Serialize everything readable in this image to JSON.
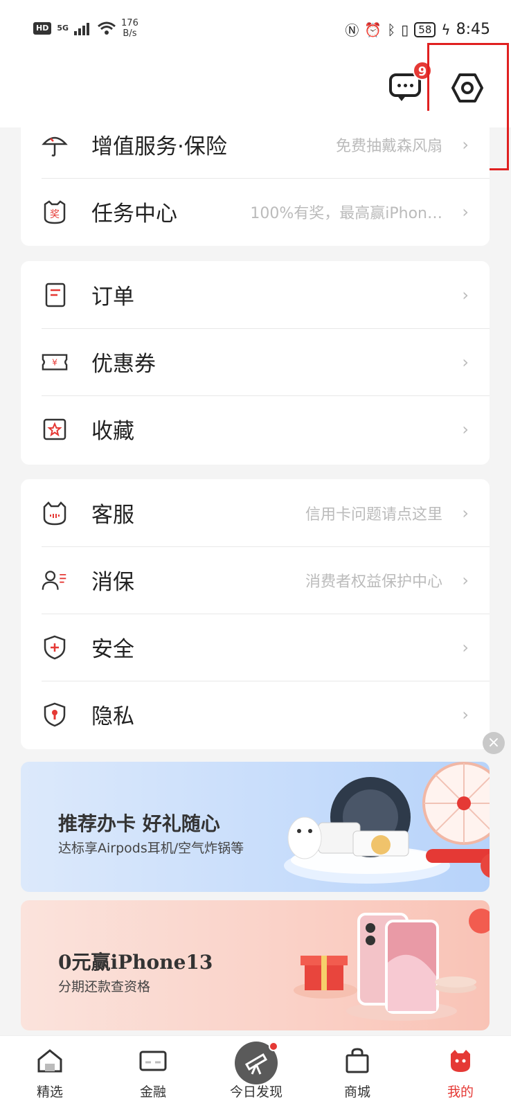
{
  "status_bar": {
    "hd": "HD",
    "network": "5G",
    "speed_value": "176",
    "speed_unit": "B/s",
    "battery": "58",
    "time": "8:45"
  },
  "header": {
    "message_badge": "9"
  },
  "card1": {
    "items": [
      {
        "label": "增值服务·保险",
        "hint": "免费抽戴森风扇",
        "icon": "umbrella-icon"
      },
      {
        "label": "任务中心",
        "hint": "100%有奖，最高赢iPhon…",
        "icon": "reward-cat-icon"
      }
    ]
  },
  "card2": {
    "items": [
      {
        "label": "订单",
        "hint": "",
        "icon": "order-icon"
      },
      {
        "label": "优惠券",
        "hint": "",
        "icon": "coupon-icon"
      },
      {
        "label": "收藏",
        "hint": "",
        "icon": "favorite-icon"
      }
    ]
  },
  "card3": {
    "items": [
      {
        "label": "客服",
        "hint": "信用卡问题请点这里",
        "icon": "customer-service-icon"
      },
      {
        "label": "消保",
        "hint": "消费者权益保护中心",
        "icon": "consumer-protection-icon"
      },
      {
        "label": "安全",
        "hint": "",
        "icon": "security-shield-icon"
      },
      {
        "label": "隐私",
        "hint": "",
        "icon": "privacy-shield-icon"
      }
    ]
  },
  "banners": {
    "card_offer": {
      "title": "推荐办卡 好礼随心",
      "subtitle": "达标享Airpods耳机/空气炸锅等"
    },
    "iphone_offer": {
      "title": "0元赢iPhone13",
      "subtitle": "分期还款查资格"
    }
  },
  "nav": {
    "items": [
      {
        "label": "精选",
        "icon": "home-icon"
      },
      {
        "label": "金融",
        "icon": "card-icon"
      },
      {
        "label": "今日发现",
        "icon": "telescope-icon"
      },
      {
        "label": "商城",
        "icon": "shopping-bag-icon"
      },
      {
        "label": "我的",
        "icon": "profile-cat-icon"
      }
    ]
  },
  "colors": {
    "accent": "#e53935",
    "highlight_box": "#e02020"
  }
}
